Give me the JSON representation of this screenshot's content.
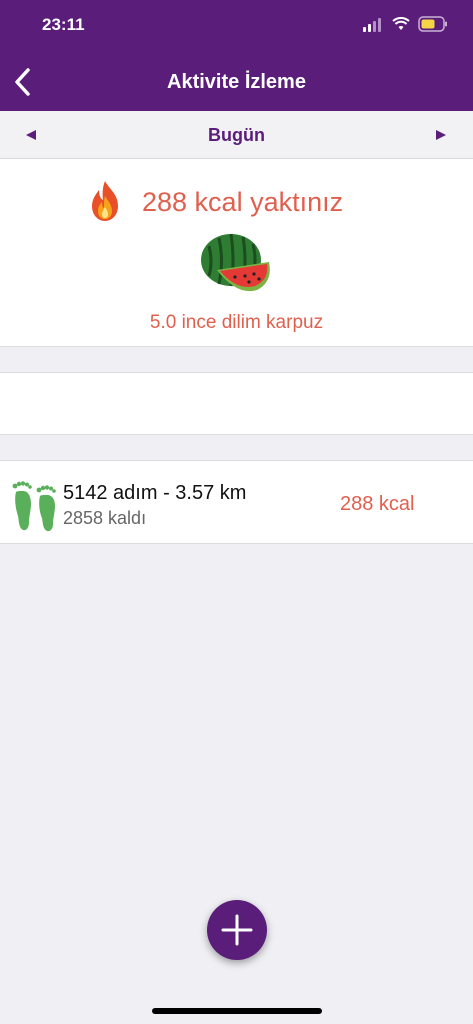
{
  "status_bar": {
    "time": "23:11"
  },
  "header": {
    "title": "Aktivite İzleme",
    "back_icon": "chevron-left-icon"
  },
  "date_nav": {
    "label": "Bugün",
    "prev_icon": "triangle-left-icon",
    "next_icon": "triangle-right-icon"
  },
  "summary": {
    "kcal_text": "288 kcal yaktınız",
    "equivalent_text": "5.0 ince dilim karpuz",
    "fire_icon": "fire-icon",
    "food_icon": "watermelon-icon"
  },
  "steps": {
    "main_text": "5142 adım - 3.57 km",
    "remaining_text": "2858 kaldı",
    "kcal_text": "288 kcal",
    "icon": "footprints-icon"
  },
  "fab": {
    "icon": "plus-icon"
  },
  "colors": {
    "brand": "#5a1d7a",
    "accent": "#e0604e",
    "footprints": "#5aaf5a"
  }
}
